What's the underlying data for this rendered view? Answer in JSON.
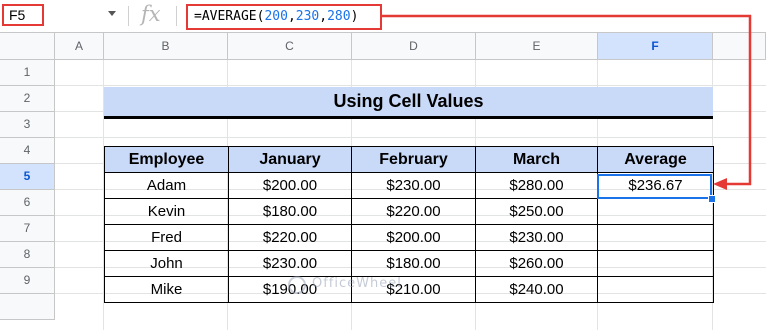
{
  "formula_bar": {
    "cell_ref": "F5",
    "fx_label": "fx",
    "formula_prefix": "=AVERAGE(",
    "formula_args": [
      "200",
      "230",
      "280"
    ],
    "formula_suffix": ")"
  },
  "sheet": {
    "columns": [
      "A",
      "B",
      "C",
      "D",
      "E",
      "F"
    ],
    "rows": [
      "1",
      "2",
      "3",
      "4",
      "5",
      "6",
      "7",
      "8",
      "9"
    ],
    "active_column": "F",
    "active_row": "5",
    "title": "Using Cell Values",
    "table": {
      "headers": [
        "Employee",
        "January",
        "February",
        "March",
        "Average"
      ],
      "rows": [
        [
          "Adam",
          "$200.00",
          "$230.00",
          "$280.00",
          "$236.67"
        ],
        [
          "Kevin",
          "$180.00",
          "$220.00",
          "$250.00",
          ""
        ],
        [
          "Fred",
          "$220.00",
          "$200.00",
          "$230.00",
          ""
        ],
        [
          "John",
          "$230.00",
          "$180.00",
          "$260.00",
          ""
        ],
        [
          "Mike",
          "$190.00",
          "$210.00",
          "$240.00",
          ""
        ]
      ]
    }
  },
  "watermark": "OfficeWheel",
  "colors": {
    "highlight_red": "#e53935",
    "header_fill": "#c9daf8",
    "selection_blue": "#1a73e8"
  }
}
